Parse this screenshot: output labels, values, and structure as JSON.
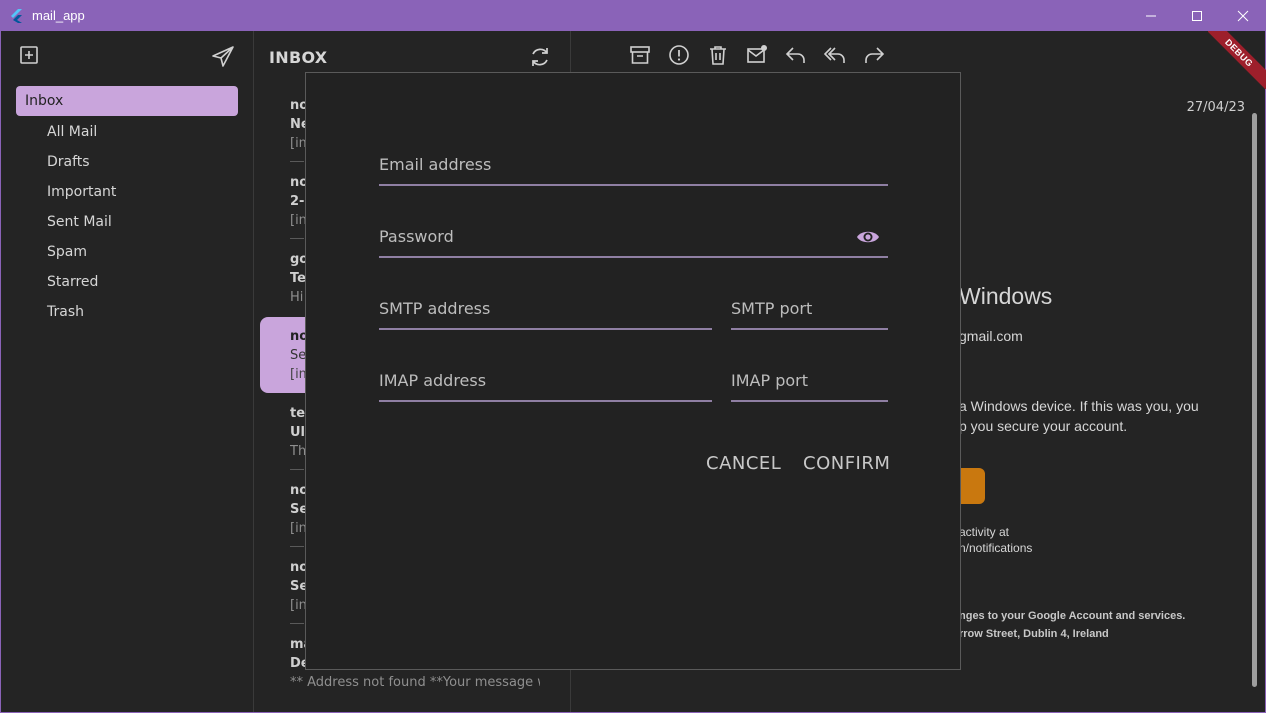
{
  "window": {
    "title": "mail_app"
  },
  "sidebar": {
    "items": [
      {
        "label": "Inbox",
        "active": true
      },
      {
        "label": "All Mail"
      },
      {
        "label": "Drafts"
      },
      {
        "label": "Important"
      },
      {
        "label": "Sent Mail"
      },
      {
        "label": "Spam"
      },
      {
        "label": "Starred"
      },
      {
        "label": "Trash"
      }
    ]
  },
  "inbox": {
    "title": "INBOX",
    "mails": [
      {
        "from": "no",
        "subject": "Ne",
        "preview": "[im"
      },
      {
        "from": "no",
        "subject": "2-",
        "preview": "[in"
      },
      {
        "from": "go",
        "subject": "Te",
        "preview": "Hi"
      },
      {
        "from": "no",
        "subject": "Se",
        "preview": "[im"
      },
      {
        "from": "te",
        "subject": "Ul",
        "preview": "Th"
      },
      {
        "from": "no",
        "subject": "Se",
        "preview": "[in"
      },
      {
        "from": "no",
        "subject": "Se",
        "preview": "[in"
      },
      {
        "from": "ma",
        "subject": "De",
        "preview": "** Address not found **Your message w"
      }
    ]
  },
  "reader": {
    "date": "27/04/23",
    "heading": "Windows",
    "email_fragment": "gmail.com",
    "body_line1": "a Windows device. If this was you, you",
    "body_line2": "p you secure your account.",
    "activity_line1": "activity at",
    "activity_line2": "n/notifications",
    "footer_line1": "nges to your Google Account and services.",
    "footer_line2": "rrow Street, Dublin 4, Ireland",
    "accent_color": "#c9780f"
  },
  "debug_banner": "DEBUG",
  "dialog": {
    "email_label": "Email address",
    "password_label": "Password",
    "smtp_address_label": "SMTP address",
    "smtp_port_label": "SMTP port",
    "imap_address_label": "IMAP address",
    "imap_port_label": "IMAP port",
    "cancel_label": "CANCEL",
    "confirm_label": "CONFIRM",
    "accent_color": "#c9a5dc"
  }
}
